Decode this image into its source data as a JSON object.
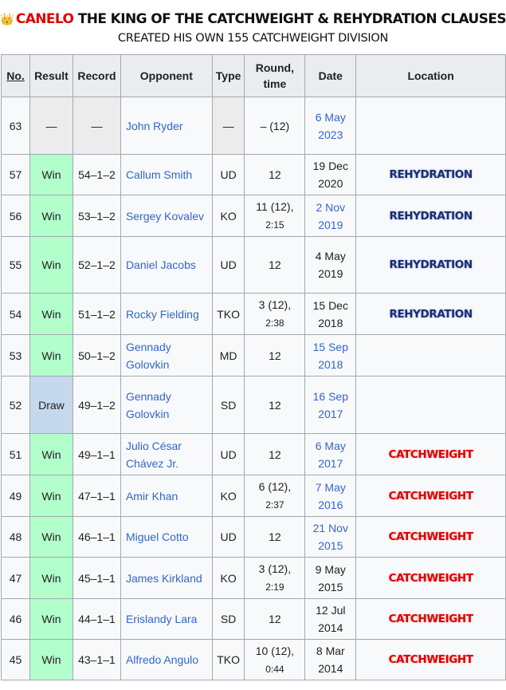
{
  "header": {
    "crown_icon": "👑",
    "title_red": "CANELO",
    "title_rest": " THE KING OF THE CATCHWEIGHT & REHYDRATION CLAUSES",
    "subtitle": "CREATED HIS OWN 155 CATCHWEIGHT DIVISION"
  },
  "columns": {
    "no": "No.",
    "result": "Result",
    "record": "Record",
    "opponent": "Opponent",
    "type": "Type",
    "round_1": "Round,",
    "round_2": "time",
    "date": "Date",
    "location": "Location"
  },
  "rows": [
    {
      "no": "63",
      "result": "—",
      "record": "—",
      "opp1": "John Ryder",
      "opp2": "",
      "type": "—",
      "round1": "– (12)",
      "round2": "",
      "date1": "6 May",
      "date2": "2023",
      "loc": ""
    },
    {
      "no": "57",
      "result": "Win",
      "record": "54–1–2",
      "opp1": "Callum Smith",
      "opp2": "",
      "type": "UD",
      "round1": "12",
      "round2": "",
      "date1": "19 Dec",
      "date2": "2020",
      "loc": "REHYDRATION"
    },
    {
      "no": "56",
      "result": "Win",
      "record": "53–1–2",
      "opp1": "Sergey Kovalev",
      "opp2": "",
      "type": "KO",
      "round1": "11 (12),",
      "round2": "2:15",
      "date1": "2 Nov",
      "date2": "2019",
      "loc": "REHYDRATION"
    },
    {
      "no": "55",
      "result": "Win",
      "record": "52–1–2",
      "opp1": "Daniel Jacobs",
      "opp2": "",
      "type": "UD",
      "round1": "12",
      "round2": "",
      "date1": "4 May",
      "date2": "2019",
      "loc": "REHYDRATION"
    },
    {
      "no": "54",
      "result": "Win",
      "record": "51–1–2",
      "opp1": "Rocky Fielding",
      "opp2": "",
      "type": "TKO",
      "round1": "3 (12),",
      "round2": "2:38",
      "date1": "15 Dec",
      "date2": "2018",
      "loc": "REHYDRATION"
    },
    {
      "no": "53",
      "result": "Win",
      "record": "50–1–2",
      "opp1": "Gennady",
      "opp2": "Golovkin",
      "type": "MD",
      "round1": "12",
      "round2": "",
      "date1": "15 Sep",
      "date2": "2018",
      "loc": ""
    },
    {
      "no": "52",
      "result": "Draw",
      "record": "49–1–2",
      "opp1": "Gennady",
      "opp2": "Golovkin",
      "type": "SD",
      "round1": "12",
      "round2": "",
      "date1": "16 Sep",
      "date2": "2017",
      "loc": ""
    },
    {
      "no": "51",
      "result": "Win",
      "record": "49–1–1",
      "opp1": "Julio César",
      "opp2": "Chávez Jr.",
      "type": "UD",
      "round1": "12",
      "round2": "",
      "date1": "6 May",
      "date2": "2017",
      "loc": "CATCHWEIGHT"
    },
    {
      "no": "49",
      "result": "Win",
      "record": "47–1–1",
      "opp1": "Amir Khan",
      "opp2": "",
      "type": "KO",
      "round1": "6 (12),",
      "round2": "2:37",
      "date1": "7 May",
      "date2": "2016",
      "loc": "CATCHWEIGHT"
    },
    {
      "no": "48",
      "result": "Win",
      "record": "46–1–1",
      "opp1": "Miguel Cotto",
      "opp2": "",
      "type": "UD",
      "round1": "12",
      "round2": "",
      "date1": "21 Nov",
      "date2": "2015",
      "loc": "CATCHWEIGHT"
    },
    {
      "no": "47",
      "result": "Win",
      "record": "45–1–1",
      "opp1": "James Kirkland",
      "opp2": "",
      "type": "KO",
      "round1": "3 (12),",
      "round2": "2:19",
      "date1": "9 May",
      "date2": "2015",
      "loc": "CATCHWEIGHT"
    },
    {
      "no": "46",
      "result": "Win",
      "record": "44–1–1",
      "opp1": "Erislandy Lara",
      "opp2": "",
      "type": "SD",
      "round1": "12",
      "round2": "",
      "date1": "12 Jul",
      "date2": "2014",
      "loc": "CATCHWEIGHT"
    },
    {
      "no": "45",
      "result": "Win",
      "record": "43–1–1",
      "opp1": "Alfredo Angulo",
      "opp2": "",
      "type": "TKO",
      "round1": "10 (12),",
      "round2": "0:44",
      "date1": "8 Mar",
      "date2": "2014",
      "loc": "CATCHWEIGHT"
    }
  ],
  "colors": {
    "win": "#b3ffcc",
    "draw": "#c6d9ec",
    "link": "#3366cc",
    "catch": "#e00000",
    "rehy": "#1e2d6e"
  }
}
